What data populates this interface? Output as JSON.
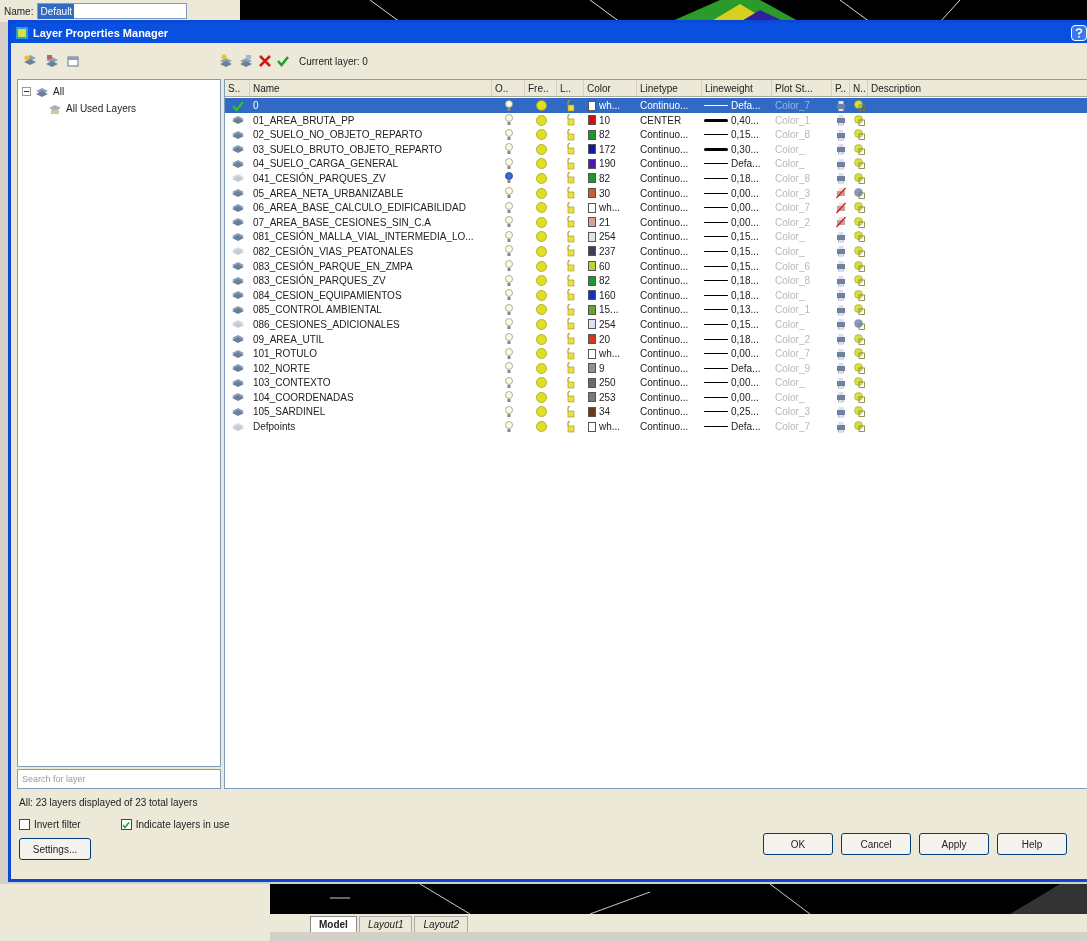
{
  "app": {
    "name_label": "Name:",
    "name_value": "Default",
    "tabs": [
      {
        "label": "Model",
        "selected": true
      },
      {
        "label": "Layout1",
        "selected": false
      },
      {
        "label": "Layout2",
        "selected": false
      }
    ]
  },
  "window": {
    "title": "Layer Properties Manager"
  },
  "current_layer": "Current layer: 0",
  "filter_tree": [
    {
      "label": "All",
      "expanded": true,
      "children": [
        {
          "label": "All Used Layers"
        }
      ]
    }
  ],
  "search": {
    "placeholder": "Search for layer"
  },
  "table": {
    "columns": [
      "S..",
      "Name",
      "O..",
      "Fre..",
      "L..",
      "Color",
      "Linetype",
      "Lineweight",
      "Plot St...",
      "P..",
      "N..",
      "Description"
    ],
    "rows": [
      {
        "kind": "current",
        "name": "0",
        "on": true,
        "color": "#ffffff",
        "color_name": "wh...",
        "linetype": "Continuo...",
        "heavy": false,
        "lineweight": "Defa...",
        "plot_style": "Color_7",
        "plot": true,
        "vp_frozen": false,
        "selected": true
      },
      {
        "kind": "used",
        "name": "01_AREA_BRUTA_PP",
        "on": true,
        "color": "#d01010",
        "color_name": "10",
        "linetype": "CENTER",
        "heavy": true,
        "lineweight": "0,40...",
        "plot_style": "Color_1",
        "plot": true,
        "vp_frozen": false,
        "selected": false
      },
      {
        "kind": "used",
        "name": "02_SUELO_NO_OBJETO_REPARTO",
        "on": true,
        "color": "#1a9a2a",
        "color_name": "82",
        "linetype": "Continuo...",
        "heavy": false,
        "lineweight": "0,15...",
        "plot_style": "Color_8",
        "plot": true,
        "vp_frozen": false,
        "selected": false
      },
      {
        "kind": "used",
        "name": "03_SUELO_BRUTO_OBJETO_REPARTO",
        "on": true,
        "color": "#101aa0",
        "color_name": "172",
        "linetype": "Continuo...",
        "heavy": true,
        "lineweight": "0,30...",
        "plot_style": "Color_",
        "plot": true,
        "vp_frozen": false,
        "selected": false
      },
      {
        "kind": "used",
        "name": "04_SUELO_CARGA_GENERAL",
        "on": true,
        "color": "#4a1ab0",
        "color_name": "190",
        "linetype": "Continuo...",
        "heavy": false,
        "lineweight": "Defa...",
        "plot_style": "Color_",
        "plot": true,
        "vp_frozen": false,
        "selected": false
      },
      {
        "kind": "unused",
        "name": "041_CESIÓN_PARQUES_ZV",
        "on": false,
        "color": "#1a9a2a",
        "color_name": "82",
        "linetype": "Continuo...",
        "heavy": false,
        "lineweight": "0,18...",
        "plot_style": "Color_8",
        "plot": true,
        "vp_frozen": false,
        "selected": false
      },
      {
        "kind": "used",
        "name": "05_AREA_NETA_URBANIZABLE",
        "on": true,
        "color": "#c8602a",
        "color_name": "30",
        "linetype": "Continuo...",
        "heavy": false,
        "lineweight": "0,00...",
        "plot_style": "Color_3",
        "plot": false,
        "vp_frozen": true,
        "selected": false
      },
      {
        "kind": "used",
        "name": "06_AREA_BASE_CALCULO_EDIFICABILIDAD",
        "on": true,
        "color": "#ffffff",
        "color_name": "wh...",
        "linetype": "Continuo...",
        "heavy": false,
        "lineweight": "0,00...",
        "plot_style": "Color_7",
        "plot": false,
        "vp_frozen": false,
        "selected": false
      },
      {
        "kind": "used",
        "name": "07_AREA_BASE_CESIONES_SIN_C.A",
        "on": true,
        "color": "#d8a090",
        "color_name": "21",
        "linetype": "Continuo...",
        "heavy": false,
        "lineweight": "0,00...",
        "plot_style": "Color_2",
        "plot": false,
        "vp_frozen": false,
        "selected": false
      },
      {
        "kind": "used",
        "name": "081_CESIÓN_MALLA_VIAL_INTERMEDIA_LO...",
        "on": true,
        "color": "#e4e4e4",
        "color_name": "254",
        "linetype": "Continuo...",
        "heavy": false,
        "lineweight": "0,15...",
        "plot_style": "Color_",
        "plot": true,
        "vp_frozen": false,
        "selected": false
      },
      {
        "kind": "unused",
        "name": "082_CESIÓN_VIAS_PEATONALES",
        "on": true,
        "color": "#4a3a5a",
        "color_name": "237",
        "linetype": "Continuo...",
        "heavy": false,
        "lineweight": "0,15...",
        "plot_style": "Color_",
        "plot": true,
        "vp_frozen": false,
        "selected": false
      },
      {
        "kind": "used",
        "name": "083_CESIÓN_PARQUE_EN_ZMPA",
        "on": true,
        "color": "#b8d830",
        "color_name": "60",
        "linetype": "Continuo...",
        "heavy": false,
        "lineweight": "0,15...",
        "plot_style": "Color_6",
        "plot": true,
        "vp_frozen": false,
        "selected": false
      },
      {
        "kind": "used",
        "name": "083_CESIÓN_PARQUES_ZV",
        "on": true,
        "color": "#1a9a2a",
        "color_name": "82",
        "linetype": "Continuo...",
        "heavy": false,
        "lineweight": "0,18...",
        "plot_style": "Color_8",
        "plot": true,
        "vp_frozen": false,
        "selected": false
      },
      {
        "kind": "used",
        "name": "084_CESION_EQUIPAMIENTOS",
        "on": true,
        "color": "#1030d0",
        "color_name": "160",
        "linetype": "Continuo...",
        "heavy": false,
        "lineweight": "0,18...",
        "plot_style": "Color_",
        "plot": true,
        "vp_frozen": false,
        "selected": false
      },
      {
        "kind": "used",
        "name": "085_CONTROL AMBIENTAL",
        "on": true,
        "color": "#6aa030",
        "color_name": "15...",
        "linetype": "Continuo...",
        "heavy": false,
        "lineweight": "0,13...",
        "plot_style": "Color_1",
        "plot": true,
        "vp_frozen": false,
        "selected": false
      },
      {
        "kind": "unused",
        "name": "086_CESIONES_ADICIONALES",
        "on": true,
        "color": "#d8e4f4",
        "color_name": "254",
        "linetype": "Continuo...",
        "heavy": false,
        "lineweight": "0,15...",
        "plot_style": "Color_",
        "plot": true,
        "vp_frozen": true,
        "selected": false
      },
      {
        "kind": "used",
        "name": "09_AREA_UTIL",
        "on": true,
        "color": "#d03a1a",
        "color_name": "20",
        "linetype": "Continuo...",
        "heavy": false,
        "lineweight": "0,18...",
        "plot_style": "Color_2",
        "plot": true,
        "vp_frozen": false,
        "selected": false
      },
      {
        "kind": "used",
        "name": "101_ROTULO",
        "on": true,
        "color": "#ffffff",
        "color_name": "wh...",
        "linetype": "Continuo...",
        "heavy": false,
        "lineweight": "0,00...",
        "plot_style": "Color_7",
        "plot": true,
        "vp_frozen": false,
        "selected": false
      },
      {
        "kind": "used",
        "name": "102_NORTE",
        "on": true,
        "color": "#909090",
        "color_name": "9",
        "linetype": "Continuo...",
        "heavy": false,
        "lineweight": "Defa...",
        "plot_style": "Color_9",
        "plot": true,
        "vp_frozen": false,
        "selected": false
      },
      {
        "kind": "used",
        "name": "103_CONTEXTO",
        "on": true,
        "color": "#6a6a6a",
        "color_name": "250",
        "linetype": "Continuo...",
        "heavy": false,
        "lineweight": "0,00...",
        "plot_style": "Color_",
        "plot": true,
        "vp_frozen": false,
        "selected": false
      },
      {
        "kind": "used",
        "name": "104_COORDENADAS",
        "on": true,
        "color": "#7a7a7a",
        "color_name": "253",
        "linetype": "Continuo...",
        "heavy": false,
        "lineweight": "0,00...",
        "plot_style": "Color_",
        "plot": true,
        "vp_frozen": false,
        "selected": false
      },
      {
        "kind": "used",
        "name": "105_SARDINEL",
        "on": true,
        "color": "#6a3a1a",
        "color_name": "34",
        "linetype": "Continuo...",
        "heavy": false,
        "lineweight": "0,25...",
        "plot_style": "Color_3",
        "plot": true,
        "vp_frozen": false,
        "selected": false
      },
      {
        "kind": "unused",
        "name": "Defpoints",
        "on": true,
        "color": "#ffffff",
        "color_name": "wh...",
        "linetype": "Continuo...",
        "heavy": false,
        "lineweight": "Defa...",
        "plot_style": "Color_7",
        "plot": true,
        "vp_frozen": false,
        "selected": false
      }
    ]
  },
  "status_text": "All: 23 layers displayed of 23 total layers",
  "options": [
    {
      "label": "Invert filter",
      "checked": false
    },
    {
      "label": "Indicate layers in use",
      "checked": true
    }
  ],
  "settings_button": "Settings...",
  "buttons": [
    "OK",
    "Cancel",
    "Apply",
    "Help"
  ]
}
